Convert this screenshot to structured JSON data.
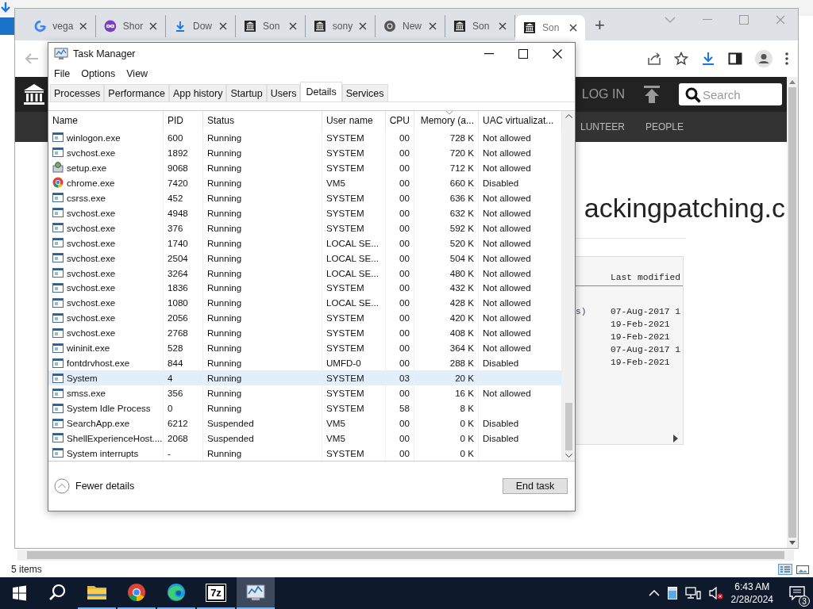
{
  "explorer": {
    "status": "5 items"
  },
  "browser": {
    "tabs": [
      {
        "kind": "google",
        "label": "vega",
        "selected": false
      },
      {
        "kind": "loop",
        "label": "Shor",
        "selected": false
      },
      {
        "kind": "download",
        "label": "Dow",
        "selected": false
      },
      {
        "kind": "museum",
        "label": "Son",
        "selected": false
      },
      {
        "kind": "museum",
        "label": "sony",
        "selected": false
      },
      {
        "kind": "chrome",
        "label": "New",
        "selected": false
      },
      {
        "kind": "museum",
        "label": "Son",
        "selected": false
      },
      {
        "kind": "museum",
        "label": "Son",
        "selected": true
      }
    ],
    "new_tab": "+"
  },
  "site": {
    "login": "LOG IN",
    "search": {
      "placeholder": "Search"
    },
    "nav": [
      "LUNTEER",
      "PEOPLE"
    ],
    "heading": "ackingpatching.c",
    "listing": {
      "header": "Last modified",
      "rows": [
        {
          "column_1": "s)",
          "column_2": "07-Aug-2017 1"
        },
        {
          "column_1": "",
          "column_2": "19-Feb-2021"
        },
        {
          "column_1": "",
          "column_2": "19-Feb-2021"
        },
        {
          "column_1": "",
          "column_2": "07-Aug-2017 1"
        },
        {
          "column_1": "",
          "column_2": "19-Feb-2021"
        }
      ]
    }
  },
  "task_manager": {
    "title": "Task Manager",
    "menu": [
      "File",
      "Options",
      "View"
    ],
    "tabs": [
      {
        "label": "Processes",
        "selected": false
      },
      {
        "label": "Performance",
        "selected": false
      },
      {
        "label": "App history",
        "selected": false
      },
      {
        "label": "Startup",
        "selected": false
      },
      {
        "label": "Users",
        "selected": false
      },
      {
        "label": "Details",
        "selected": true
      },
      {
        "label": "Services",
        "selected": false
      }
    ],
    "columns": [
      {
        "label": "Name",
        "sorted": false
      },
      {
        "label": "PID",
        "sorted": false
      },
      {
        "label": "Status",
        "sorted": false
      },
      {
        "label": "User name",
        "sorted": false
      },
      {
        "label": "CPU",
        "sorted": false
      },
      {
        "label": "Memory (a...",
        "sorted": true
      },
      {
        "label": "UAC virtualizat...",
        "sorted": false
      }
    ],
    "rows": [
      {
        "kind": "app",
        "name": "winlogon.exe",
        "pid": "600",
        "status": "Running",
        "user": "SYSTEM",
        "cpu": "00",
        "memory": "728 K",
        "uac": "Not allowed",
        "selected": false
      },
      {
        "kind": "app",
        "name": "svchost.exe",
        "pid": "1892",
        "status": "Running",
        "user": "SYSTEM",
        "cpu": "00",
        "memory": "720 K",
        "uac": "Not allowed",
        "selected": false
      },
      {
        "kind": "setup",
        "name": "setup.exe",
        "pid": "9068",
        "status": "Running",
        "user": "SYSTEM",
        "cpu": "00",
        "memory": "712 K",
        "uac": "Not allowed",
        "selected": false
      },
      {
        "kind": "chrome",
        "name": "chrome.exe",
        "pid": "7420",
        "status": "Running",
        "user": "VM5",
        "cpu": "00",
        "memory": "660 K",
        "uac": "Disabled",
        "selected": false
      },
      {
        "kind": "app",
        "name": "csrss.exe",
        "pid": "452",
        "status": "Running",
        "user": "SYSTEM",
        "cpu": "00",
        "memory": "636 K",
        "uac": "Not allowed",
        "selected": false
      },
      {
        "kind": "app",
        "name": "svchost.exe",
        "pid": "4948",
        "status": "Running",
        "user": "SYSTEM",
        "cpu": "00",
        "memory": "632 K",
        "uac": "Not allowed",
        "selected": false
      },
      {
        "kind": "app",
        "name": "svchost.exe",
        "pid": "376",
        "status": "Running",
        "user": "SYSTEM",
        "cpu": "00",
        "memory": "592 K",
        "uac": "Not allowed",
        "selected": false
      },
      {
        "kind": "app",
        "name": "svchost.exe",
        "pid": "1740",
        "status": "Running",
        "user": "LOCAL SE...",
        "cpu": "00",
        "memory": "520 K",
        "uac": "Not allowed",
        "selected": false
      },
      {
        "kind": "app",
        "name": "svchost.exe",
        "pid": "2504",
        "status": "Running",
        "user": "LOCAL SE...",
        "cpu": "00",
        "memory": "504 K",
        "uac": "Not allowed",
        "selected": false
      },
      {
        "kind": "app",
        "name": "svchost.exe",
        "pid": "3264",
        "status": "Running",
        "user": "LOCAL SE...",
        "cpu": "00",
        "memory": "480 K",
        "uac": "Not allowed",
        "selected": false
      },
      {
        "kind": "app",
        "name": "svchost.exe",
        "pid": "1836",
        "status": "Running",
        "user": "SYSTEM",
        "cpu": "00",
        "memory": "432 K",
        "uac": "Not allowed",
        "selected": false
      },
      {
        "kind": "app",
        "name": "svchost.exe",
        "pid": "1080",
        "status": "Running",
        "user": "LOCAL SE...",
        "cpu": "00",
        "memory": "428 K",
        "uac": "Not allowed",
        "selected": false
      },
      {
        "kind": "app",
        "name": "svchost.exe",
        "pid": "2056",
        "status": "Running",
        "user": "SYSTEM",
        "cpu": "00",
        "memory": "420 K",
        "uac": "Not allowed",
        "selected": false
      },
      {
        "kind": "app",
        "name": "svchost.exe",
        "pid": "2768",
        "status": "Running",
        "user": "SYSTEM",
        "cpu": "00",
        "memory": "408 K",
        "uac": "Not allowed",
        "selected": false
      },
      {
        "kind": "app",
        "name": "wininit.exe",
        "pid": "528",
        "status": "Running",
        "user": "SYSTEM",
        "cpu": "00",
        "memory": "364 K",
        "uac": "Not allowed",
        "selected": false
      },
      {
        "kind": "app",
        "name": "fontdrvhost.exe",
        "pid": "844",
        "status": "Running",
        "user": "UMFD-0",
        "cpu": "00",
        "memory": "288 K",
        "uac": "Disabled",
        "selected": false
      },
      {
        "kind": "app",
        "name": "System",
        "pid": "4",
        "status": "Running",
        "user": "SYSTEM",
        "cpu": "03",
        "memory": "20 K",
        "uac": "",
        "selected": true
      },
      {
        "kind": "app",
        "name": "smss.exe",
        "pid": "356",
        "status": "Running",
        "user": "SYSTEM",
        "cpu": "00",
        "memory": "16 K",
        "uac": "Not allowed",
        "selected": false
      },
      {
        "kind": "app",
        "name": "System Idle Process",
        "pid": "0",
        "status": "Running",
        "user": "SYSTEM",
        "cpu": "58",
        "memory": "8 K",
        "uac": "",
        "selected": false
      },
      {
        "kind": "app",
        "name": "SearchApp.exe",
        "pid": "6212",
        "status": "Suspended",
        "user": "VM5",
        "cpu": "00",
        "memory": "0 K",
        "uac": "Disabled",
        "selected": false
      },
      {
        "kind": "app",
        "name": "ShellExperienceHost....",
        "pid": "2068",
        "status": "Suspended",
        "user": "VM5",
        "cpu": "00",
        "memory": "0 K",
        "uac": "Disabled",
        "selected": false
      },
      {
        "kind": "app",
        "name": "System interrupts",
        "pid": "-",
        "status": "Running",
        "user": "SYSTEM",
        "cpu": "00",
        "memory": "0 K",
        "uac": "",
        "selected": false
      }
    ],
    "fewer_details": "Fewer details",
    "end_task": "End task"
  },
  "taskbar": {
    "apps": [
      {
        "kind": "explorer",
        "running": true,
        "selected": false
      },
      {
        "kind": "chrome",
        "running": true,
        "selected": false
      },
      {
        "kind": "edge",
        "running": true,
        "selected": false
      },
      {
        "kind": "archiver",
        "label": "7z",
        "running": true,
        "selected": false
      },
      {
        "kind": "taskmgr",
        "running": true,
        "selected": true
      }
    ],
    "time": "6:43 AM",
    "date": "2/28/2024",
    "notifications": "3"
  }
}
